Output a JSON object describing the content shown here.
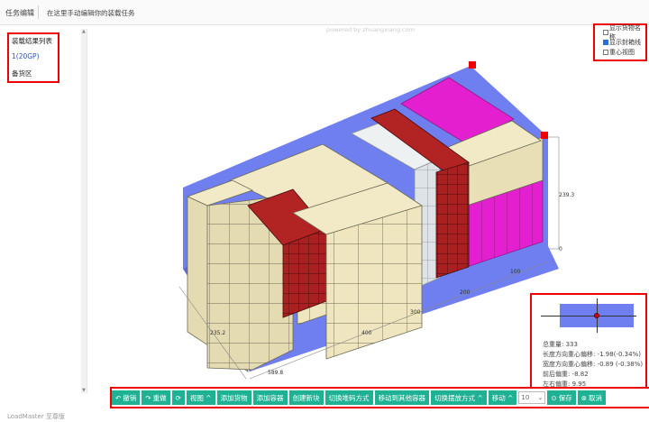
{
  "header": {
    "tab_title": "任务编辑",
    "hint": "在这里手动编辑你的装载任务"
  },
  "sidebar": {
    "items": [
      {
        "label": "装载结果列表"
      },
      {
        "label": "1(20GP)"
      },
      {
        "label": "备货区"
      }
    ]
  },
  "canvas": {
    "watermark": "powered by zhuangxiang.com",
    "options": [
      {
        "label": "显示货物名称",
        "checked": false
      },
      {
        "label": "显示封箱线",
        "checked": true
      },
      {
        "label": "重心视图",
        "checked": false
      }
    ],
    "dimensions": {
      "height": "239.3",
      "height_zero": "0",
      "depth": "235.2",
      "length_end": "589.8",
      "tick_100": "100",
      "tick_200": "200",
      "tick_300": "300",
      "tick_400": "400",
      "tick_500": "500"
    }
  },
  "stats": {
    "total_weight": "总重量: 333",
    "length_offset": "长度方向重心偏移: -1.98(-0.34%)",
    "width_offset": "宽度方向重心偏移: -0.89 (-0.38%)",
    "front_back": "前后偏重: -8.82",
    "left_right": "左右偏重: 9.95"
  },
  "toolbar": {
    "undo": "撤销",
    "redo": "重做",
    "view": "视图",
    "add_cargo": "添加货物",
    "add_container": "添加容器",
    "create_block": "创建新块",
    "switch_stack": "切换堆码方式",
    "move_to_other": "移动到其他容器",
    "switch_place": "切换摆放方式",
    "move": "移动",
    "step_value": "10",
    "save": "保存",
    "cancel": "取消"
  },
  "footer": {
    "text": "LoadMaster 至尊版"
  },
  "colors": {
    "accent": "#1fb193",
    "container_floor": "#6f7ff0",
    "cargo_beige": "#efe6bf",
    "cargo_red": "#a82020",
    "cargo_magenta": "#e41fcf",
    "cargo_grey": "#dde3e6",
    "highlight": "#ee0000"
  },
  "icons": [
    "undo-icon",
    "redo-icon",
    "refresh-icon",
    "chevron-up-icon",
    "save-icon",
    "cancel-icon",
    "chevron-down-icon"
  ]
}
